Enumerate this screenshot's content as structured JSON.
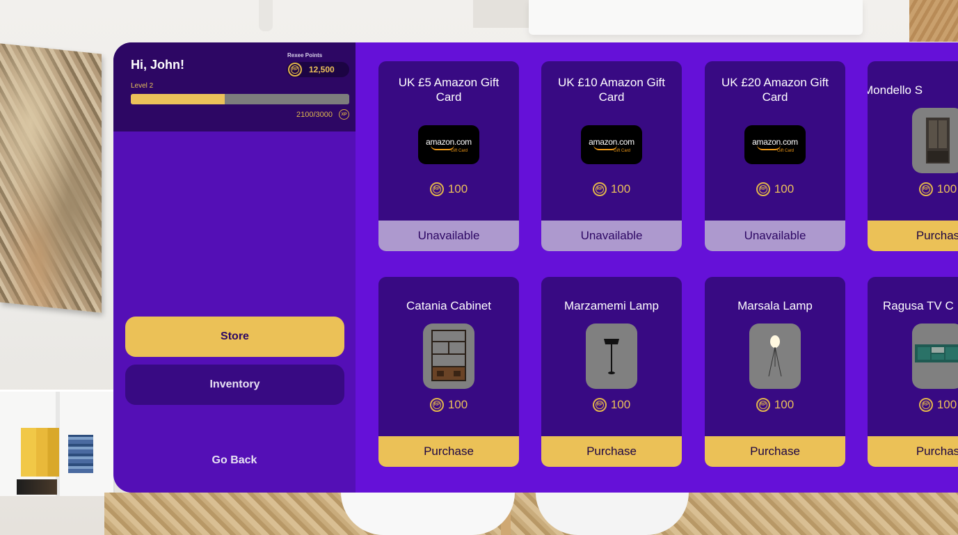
{
  "profile": {
    "greeting": "Hi, John!",
    "level": "Level 2",
    "points_label": "Rexee Points",
    "points_value": "12,500",
    "xp_text": "2100/3000",
    "xp_icon_text": "XP",
    "xp_progress": 0.43
  },
  "nav": {
    "store": "Store",
    "inventory": "Inventory",
    "go_back": "Go Back"
  },
  "items": [
    {
      "title": "UK £5 Amazon Gift Card",
      "price": "100",
      "button": "Unavailable",
      "state": "unavailable",
      "image": "amazon-gift-card"
    },
    {
      "title": "UK £10 Amazon Gift Card",
      "price": "100",
      "button": "Unavailable",
      "state": "unavailable",
      "image": "amazon-gift-card"
    },
    {
      "title": "UK £20 Amazon Gift Card",
      "price": "100",
      "button": "Unavailable",
      "state": "unavailable",
      "image": "amazon-gift-card"
    },
    {
      "title": "Mondello S",
      "price": "100",
      "button": "Purchas",
      "state": "available",
      "image": "cabinet-glass"
    },
    {
      "title": "Catania Cabinet",
      "price": "100",
      "button": "Purchase",
      "state": "available",
      "image": "bookcase-cabinet"
    },
    {
      "title": "Marzamemi Lamp",
      "price": "100",
      "button": "Purchase",
      "state": "available",
      "image": "floor-lamp-black"
    },
    {
      "title": "Marsala Lamp",
      "price": "100",
      "button": "Purchase",
      "state": "available",
      "image": "tripod-lamp"
    },
    {
      "title": "Ragusa TV C",
      "price": "100",
      "button": "Purchas",
      "state": "available",
      "image": "tv-cabinet"
    }
  ],
  "amazon_logo": {
    "word": "amazon",
    "tld": ".com",
    "sub": "Gift Card"
  },
  "colors": {
    "panel_dark": "#2d0764",
    "sidebar": "#540fb6",
    "grid": "#6511d8",
    "card": "#380a83",
    "gold": "#ebc157",
    "unavailable": "#ad99ce"
  }
}
